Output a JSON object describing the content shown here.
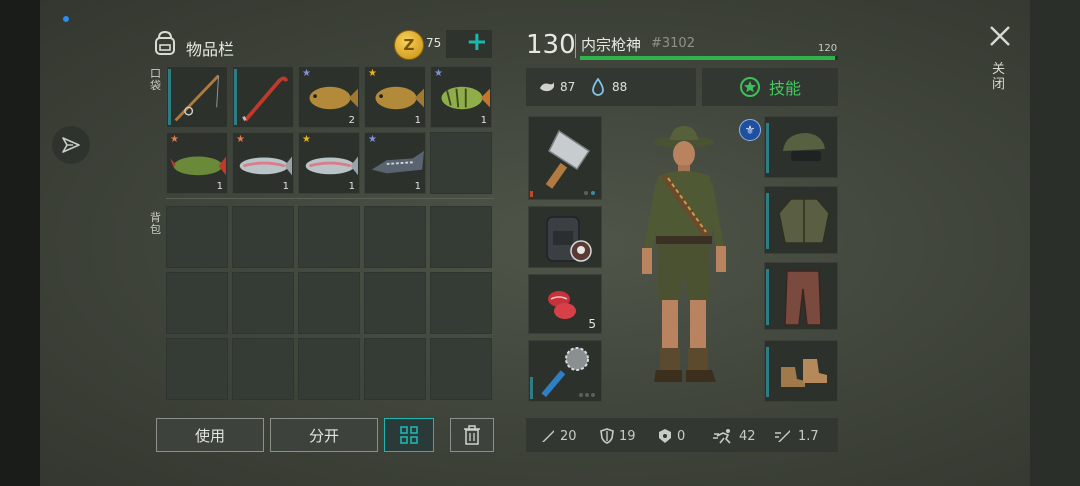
{
  "header": {
    "inventory_title": "物品栏",
    "coins": "75",
    "add_label": "+",
    "level": "130",
    "player_name": "内宗枪神",
    "player_id": "#3102",
    "xp_value": "120",
    "xp_progress": 0.99,
    "close_label": "关闭"
  },
  "side_labels": {
    "pocket": "口袋",
    "backpack": "背包"
  },
  "pocket_slots": [
    {
      "name": "fishing-rod",
      "count": "",
      "star": ""
    },
    {
      "name": "crowbar",
      "count": "",
      "star": ""
    },
    {
      "name": "carp",
      "count": "2",
      "star": "blue"
    },
    {
      "name": "carp",
      "count": "1",
      "star": "gold"
    },
    {
      "name": "perch",
      "count": "1",
      "star": "blue"
    },
    {
      "name": "pike",
      "count": "1",
      "star": "bronze"
    },
    {
      "name": "trout",
      "count": "1",
      "star": "bronze"
    },
    {
      "name": "trout",
      "count": "1",
      "star": "gold"
    },
    {
      "name": "sturgeon",
      "count": "1",
      "star": "blue"
    },
    {
      "name": "empty",
      "count": "",
      "star": ""
    }
  ],
  "needs": {
    "hunger": "87",
    "thirst": "88"
  },
  "skills_label": "技能",
  "left_equipment": [
    {
      "name": "cleaver",
      "count": ""
    },
    {
      "name": "backpack",
      "count": ""
    },
    {
      "name": "raw-meat",
      "count": "5"
    },
    {
      "name": "spiked-club",
      "count": ""
    }
  ],
  "right_equipment": [
    "cap",
    "jacket",
    "pants",
    "boots"
  ],
  "buttons": {
    "use": "使用",
    "split": "分开"
  },
  "stats": {
    "attack": "20",
    "defense": "19",
    "radiation": "0",
    "speed": "42",
    "attack_speed": "1.7"
  },
  "colors": {
    "accent": "#1fb5b0",
    "xp_bar": "#2fb34a",
    "gold": "#e8b21a"
  }
}
